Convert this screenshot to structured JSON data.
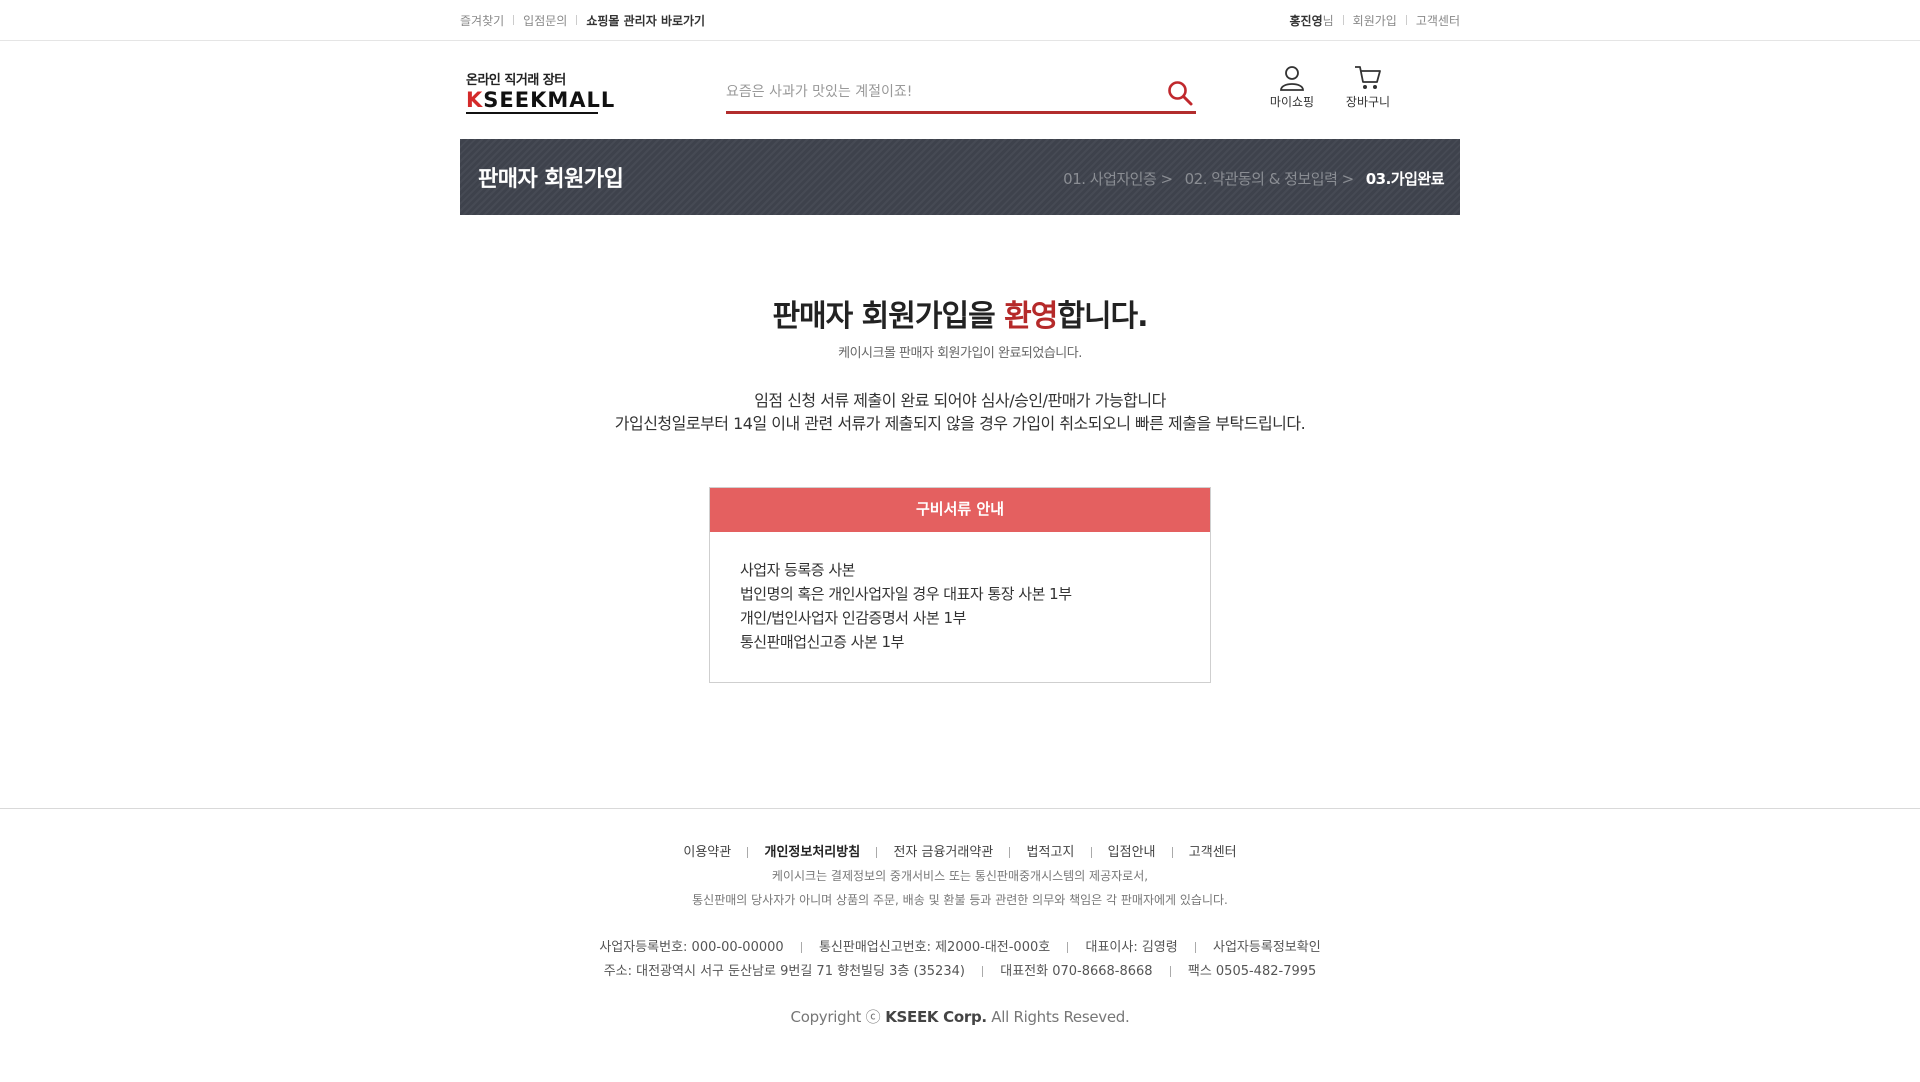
{
  "topbar": {
    "left_links": [
      "즐겨찾기",
      "입점문의"
    ],
    "admin_link": "쇼핑몰 관리자 바로가기",
    "user_name": "홍진영",
    "user_suffix": "님",
    "signup": "회원가입",
    "support": "고객센터"
  },
  "header": {
    "logo_sub": "온라인 직거래 장터",
    "logo_k": "K",
    "logo_rest": "SEEKMALL",
    "search_placeholder": "요즘은 사과가 맛있는 계절이죠!",
    "my_shopping": "마이쇼핑",
    "cart": "장바구니"
  },
  "banner": {
    "title": "판매자 회원가입",
    "steps": [
      "01. 사업자인증 >",
      "02. 약관동의 & 정보입력 >",
      "03.가입완료"
    ]
  },
  "welcome": {
    "title_pre": "판매자 회원가입을 ",
    "title_accent": "환영",
    "title_post": "합니다.",
    "subtitle": "케이시크몰 판매자 회원가입이 완료되었습니다.",
    "notice_line1": "임점 신청 서류 제출이 완료 되어야 심사/승인/판매가 가능합니다",
    "notice_line2": "가입신청일로부터 14일 이내 관련 서류가 제출되지 않을 경우 가입이 취소되오니 빠른 제출을 부탁드립니다."
  },
  "documents": {
    "header": "구비서류 안내",
    "items": [
      "사업자 등록증 사본",
      "법인명의 혹은  개인사업자일 경우 대표자 통장 사본 1부",
      "개인/법인사업자 인감증명서 사본 1부",
      "통신판매업신고증 사본 1부"
    ]
  },
  "footer": {
    "nav": [
      "이용약관",
      "개인정보처리방침",
      "전자 금융거래약관",
      "법적고지",
      "입점안내",
      "고객센터"
    ],
    "desc_line1": "케이시크는 결제정보의 중개서비스 또는 통신판매중개시스템의 제공자로서,",
    "desc_line2": "통신판매의 당사자가 아니며 상품의 주문, 배송 및 환불 등과 관련한 의무와 책임은 각 판매자에게 있습니다.",
    "biz_number": "사업자등록번호: 000-00-00000",
    "mail_order": "통신판매업신고번호:  제2000-대전-000호",
    "ceo": "대표이사: 김영령",
    "biz_check": "사업자등록정보확인",
    "address": "주소: 대전광역시 서구 둔산남로 9번길 71  향천빌딩 3층  (35234)",
    "phone": "대표전화 070-8668-8668",
    "fax": "팩스  0505-482-7995",
    "copyright_pre": "Copyright ",
    "copyright_symbol": "ⓒ",
    "copyright_brand": " KSEEK  Corp.",
    "copyright_post": " All Rights Reseved."
  },
  "colors": {
    "accent": "#b52a2a",
    "doc_header": "#e46060",
    "banner": "#3e424c"
  }
}
